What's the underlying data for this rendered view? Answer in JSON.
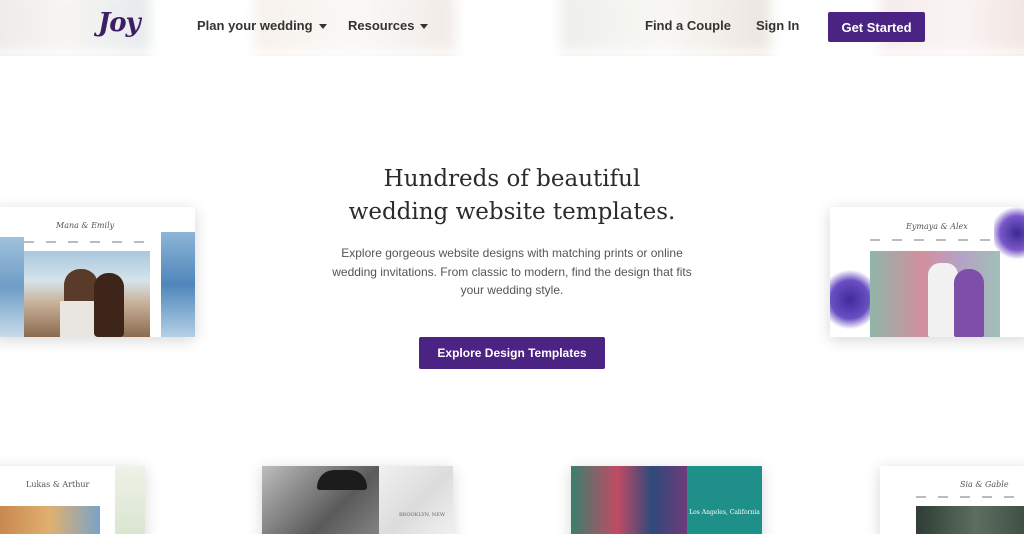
{
  "brand": {
    "logo_text": "Joy",
    "accent_color": "#4b2382"
  },
  "nav": {
    "items": [
      {
        "label": "Plan your wedding",
        "has_dropdown": true
      },
      {
        "label": "Resources",
        "has_dropdown": true
      }
    ],
    "find_couple": "Find a Couple",
    "sign_in": "Sign In",
    "get_started": "Get Started"
  },
  "hero": {
    "title_line1": "Hundreds of beautiful",
    "title_line2": "wedding website templates.",
    "description": "Explore gorgeous website designs with matching prints or online wedding invitations. From classic to modern, find the design that fits your wedding style.",
    "cta": "Explore Design Templates"
  },
  "templates": {
    "left_card_names": "Mana & Emily",
    "right_card_names": "Eymaya & Alex",
    "bottom_card1_names": "Lukas & Arthur",
    "bottom_card2_caption": "BROOKLYN, NEW",
    "bottom_card3_caption": "Los Angeles, California",
    "bottom_card4_names": "Sia & Gable"
  }
}
